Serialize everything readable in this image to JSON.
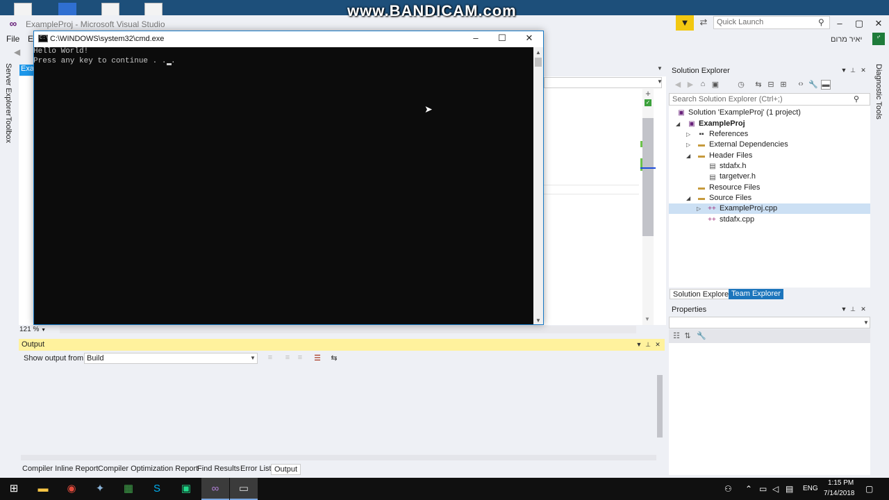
{
  "watermark": "www.BANDICAM.com",
  "vs": {
    "title": "ExampleProj - Microsoft Visual Studio",
    "quick_launch_placeholder": "Quick Launch",
    "menu": {
      "file": "File",
      "edit": "E"
    },
    "user_name": "יאיר מרום",
    "user_initial": "י'",
    "accent_color": "#f2c811"
  },
  "left_strip": {
    "server_explorer": "Server Explorer",
    "toolbox": "Toolbox"
  },
  "right_strip": {
    "diagnostic_tools": "Diagnostic Tools"
  },
  "editor": {
    "tab_label": "Exa",
    "zoom": "121 %"
  },
  "cmd": {
    "title": "C:\\WINDOWS\\system32\\cmd.exe",
    "icon_text": "C:\\",
    "lines": [
      "Hello World!",
      "Press any key to continue . . ."
    ]
  },
  "output": {
    "title": "Output",
    "show_from_label": "Show output from:",
    "source": "Build"
  },
  "bottom_tabs": [
    "Compiler Inline Report",
    "Compiler Optimization Report",
    "Find Results",
    "Error List",
    "Output"
  ],
  "solution_explorer": {
    "title": "Solution Explorer",
    "search_placeholder": "Search Solution Explorer (Ctrl+;)",
    "tree": {
      "solution": "Solution 'ExampleProj' (1 project)",
      "project": "ExampleProj",
      "references": "References",
      "external": "External Dependencies",
      "header_files": "Header Files",
      "stdafx_h": "stdafx.h",
      "targetver_h": "targetver.h",
      "resource_files": "Resource Files",
      "source_files": "Source Files",
      "example_cpp": "ExampleProj.cpp",
      "stdafx_cpp": "stdafx.cpp"
    },
    "tabs": {
      "solution_explorer": "Solution Explorer",
      "team_explorer": "Team Explorer"
    }
  },
  "properties": {
    "title": "Properties"
  },
  "taskbar": {
    "lang": "ENG",
    "time": "1:15 PM",
    "date": "7/14/2018"
  }
}
